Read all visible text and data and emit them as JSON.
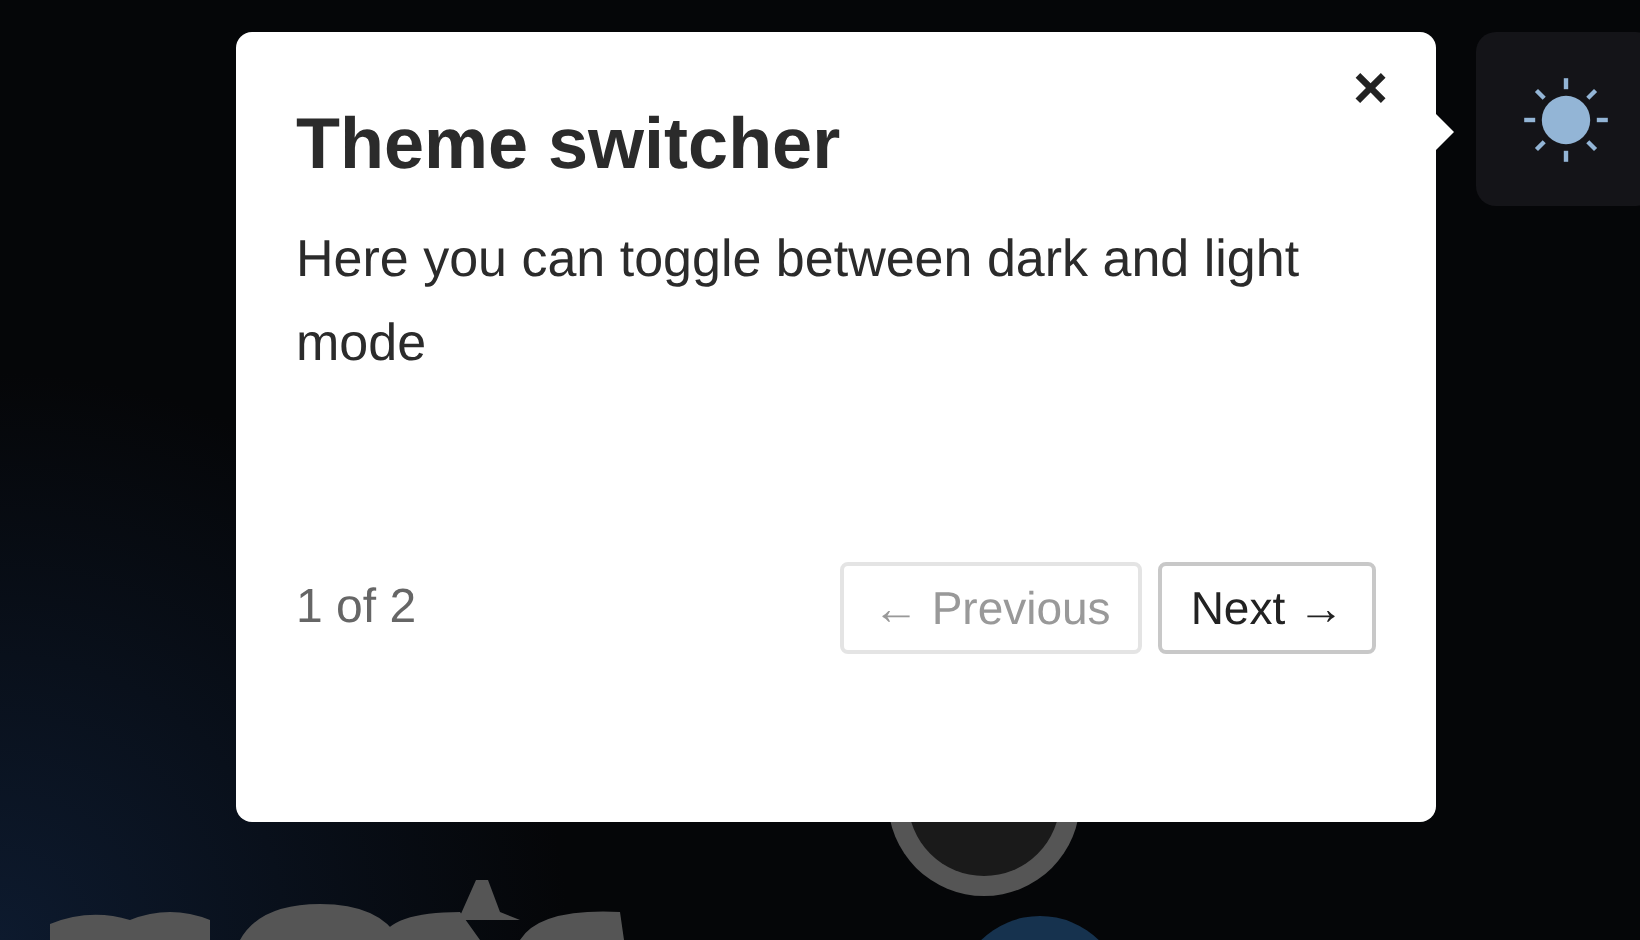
{
  "tour_popover": {
    "title": "Theme switcher",
    "close": "×",
    "body": "Here you can toggle between dark and light mode",
    "progress": "1 of 2",
    "buttons": [
      {
        "label": "← Previous",
        "disabled": true
      },
      {
        "label": "Next →",
        "disabled": false
      }
    ]
  }
}
